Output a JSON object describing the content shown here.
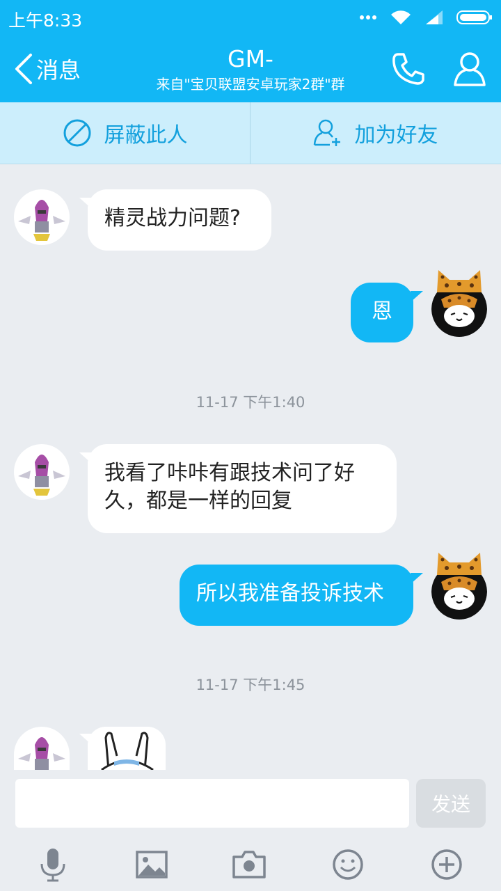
{
  "status": {
    "time": "上午8:33"
  },
  "header": {
    "back_label": "消息",
    "title": "GM-",
    "subtitle": "来自\"宝贝联盟安卓玩家2群\"群"
  },
  "actions": {
    "block": "屏蔽此人",
    "add_friend": "加为好友"
  },
  "messages": [
    {
      "from": "other",
      "text": "精灵战力问题?"
    },
    {
      "from": "me",
      "text": "恩"
    },
    {
      "from": "other",
      "text": "我看了咔咔有跟技术问了好久，都是一样的回复"
    },
    {
      "from": "me",
      "text": "所以我准备投诉技术"
    },
    {
      "from": "other",
      "type": "sticker"
    }
  ],
  "timestamps": [
    "11-17 下午1:40",
    "11-17 下午1:45"
  ],
  "composer": {
    "input_value": "",
    "send_label": "发送"
  },
  "toolbar": [
    "mic-icon",
    "image-icon",
    "camera-icon",
    "emoji-icon",
    "plus-icon"
  ],
  "colors": {
    "accent": "#12b7f5",
    "action_bar": "#cceefc",
    "action_text": "#12a0dd",
    "background": "#eaedf1"
  }
}
